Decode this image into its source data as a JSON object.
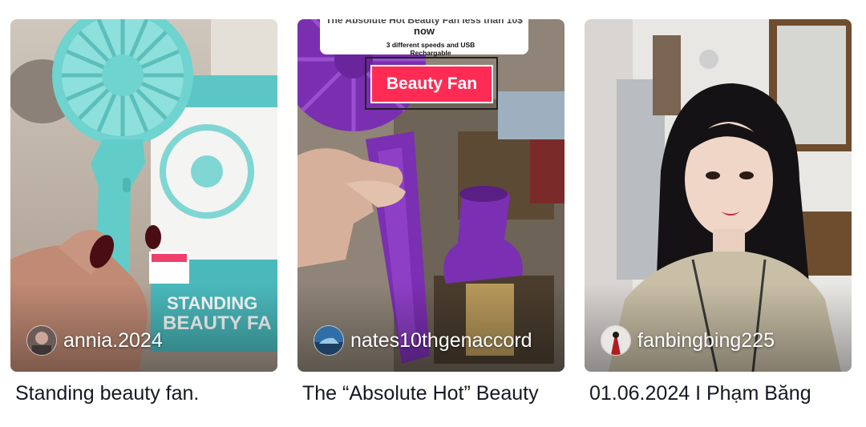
{
  "videos": [
    {
      "author": "annia.2024",
      "caption": "Standing beauty fan.",
      "thumbnail_text": [
        "STANDING",
        "BEAUTY FA"
      ]
    },
    {
      "author": "nates10thgenaccord",
      "caption": "The “Absolute Hot” Beauty",
      "thumbnail_text": {
        "headline": "The Absolute Hot Beauty Fan less than 10$",
        "headline_line2": "now",
        "subline": "3 different speeds and USB Rechargable",
        "tag": "Beauty Fan"
      }
    },
    {
      "author": "fanbingbing225",
      "caption": "01.06.2024 I Phạm Băng"
    }
  ],
  "colors": {
    "accent": "#fe2c55",
    "text": "#161823",
    "fan_teal": "#6fd3cf",
    "fan_purple": "#7a2fb0"
  }
}
